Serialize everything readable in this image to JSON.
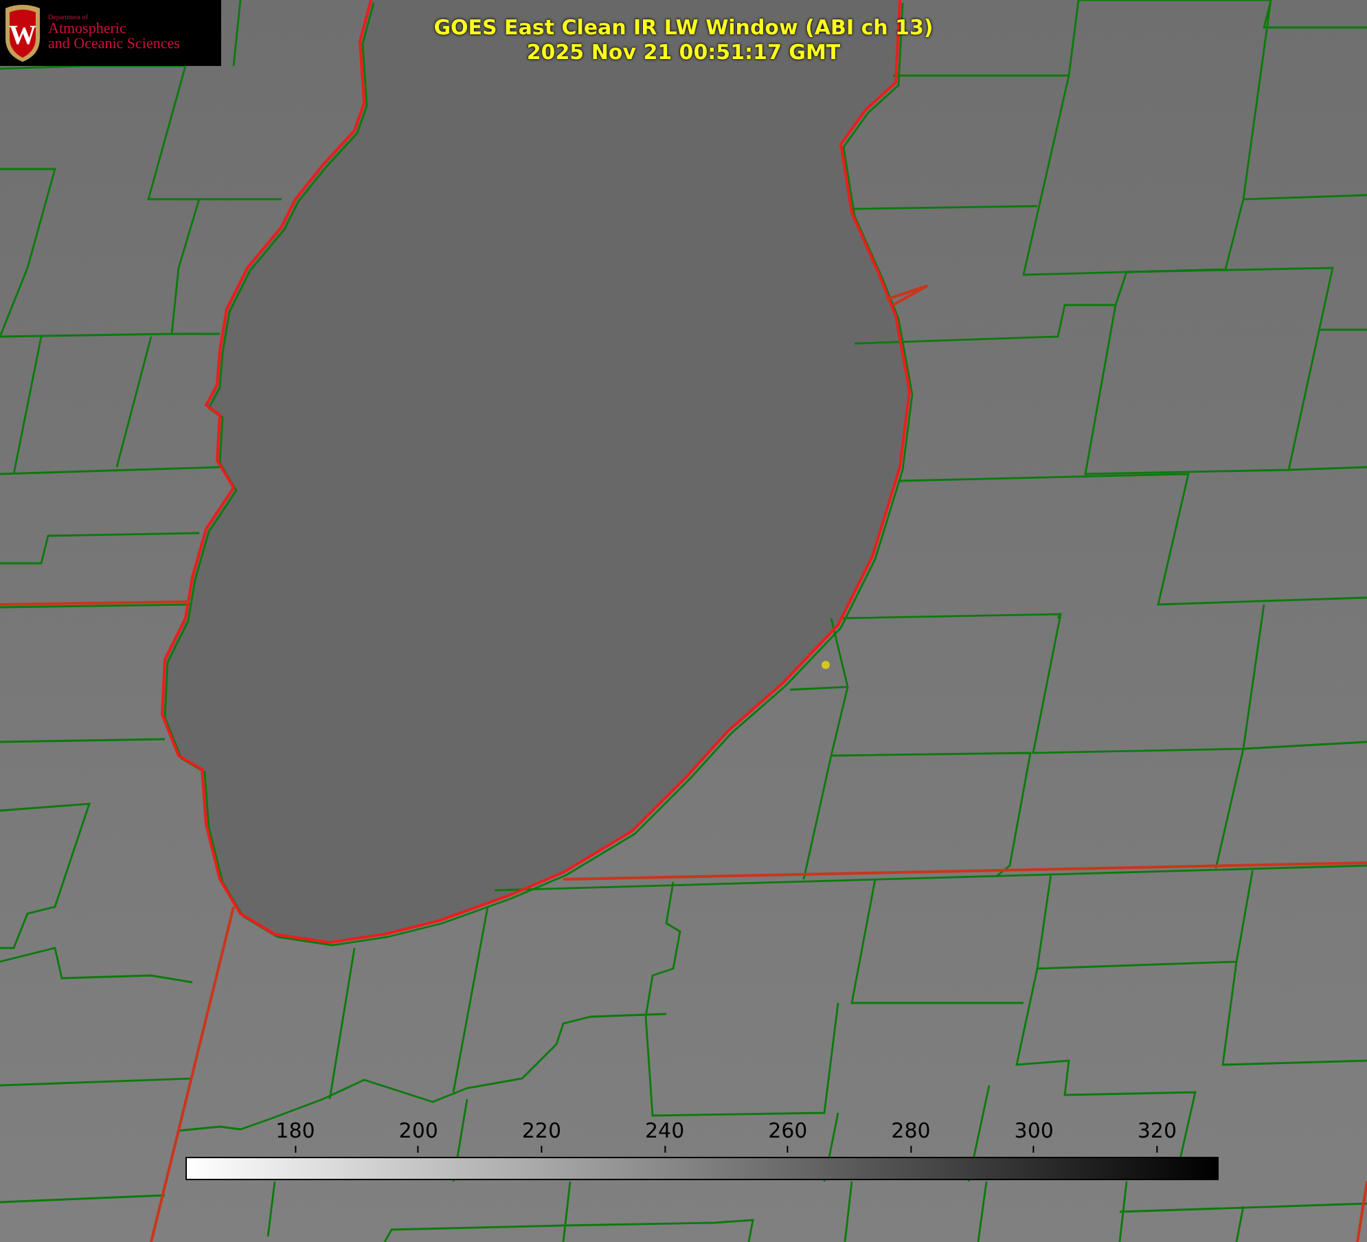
{
  "title": {
    "lines": [
      "GOES East Clean IR LW Window (ABI ch 13)",
      "2025 Nov 21 00:51:17 GMT"
    ]
  },
  "logo": {
    "emblem": "W",
    "small": "Department of",
    "lines": [
      "Atmospheric",
      "and Oceanic Sciences"
    ]
  },
  "colorbar": {
    "ticks": [
      "180",
      "200",
      "220",
      "240",
      "260",
      "280",
      "300",
      "320"
    ]
  }
}
